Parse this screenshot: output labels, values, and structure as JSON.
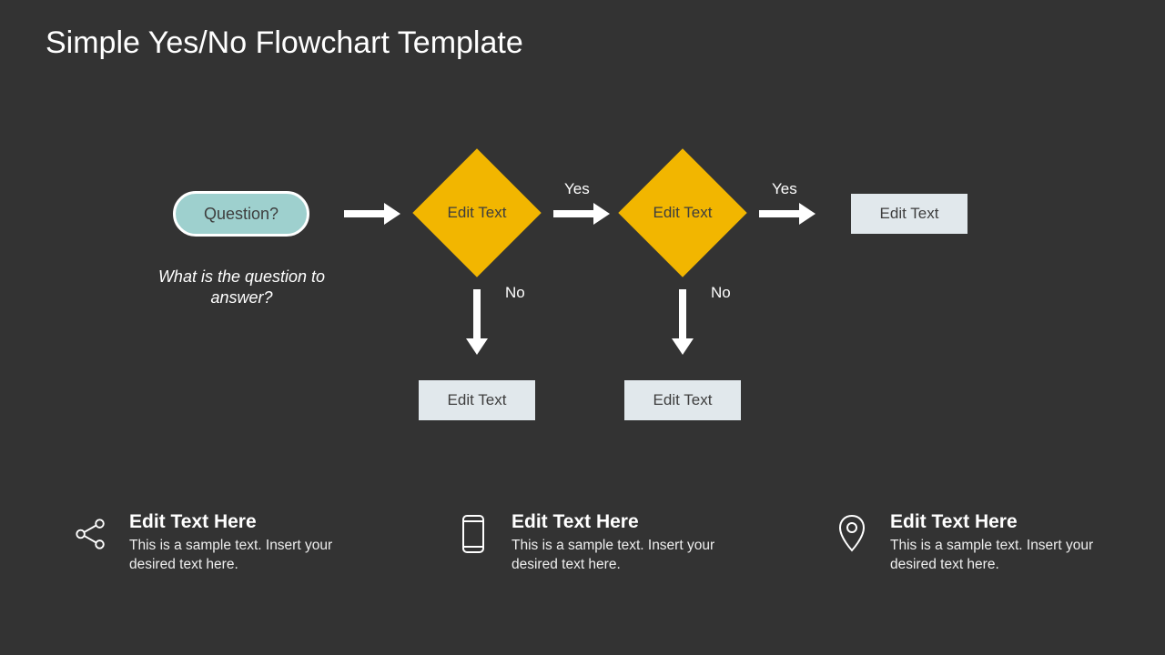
{
  "title": "Simple Yes/No Flowchart Template",
  "flow": {
    "start": "Question?",
    "caption": "What is the question to answer?",
    "decision1": "Edit Text",
    "decision2": "Edit Text",
    "resultEnd": "Edit Text",
    "resultNo1": "Edit Text",
    "resultNo2": "Edit Text",
    "labels": {
      "yes": "Yes",
      "no": "No"
    }
  },
  "footer": {
    "items": [
      {
        "title": "Edit Text Here",
        "body": "This is a sample text. Insert your desired text here."
      },
      {
        "title": "Edit Text Here",
        "body": "This is a sample text. Insert your desired text here."
      },
      {
        "title": "Edit Text Here",
        "body": "This is a sample text. Insert your desired text here."
      }
    ]
  }
}
